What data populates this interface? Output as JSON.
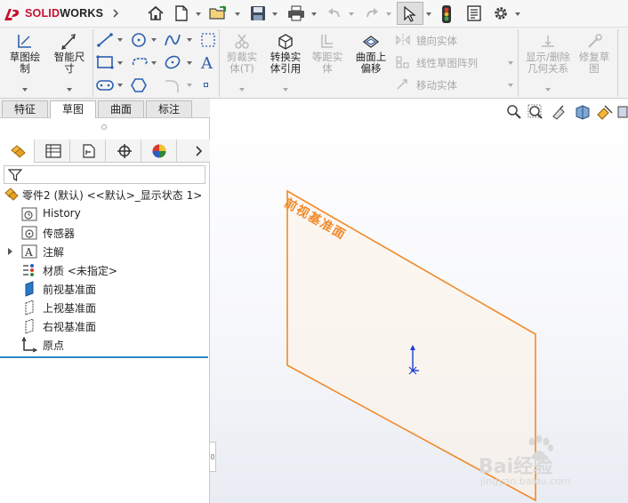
{
  "app": {
    "brand_prefix": "DS",
    "brand_name": "SOLIDWORKS"
  },
  "quick_access": {
    "icons": [
      "home-icon",
      "new-document-icon",
      "open-folder-icon",
      "save-icon",
      "print-icon",
      "undo-icon",
      "redo-icon",
      "select-pointer-icon",
      "traffic-light-icon",
      "file-properties-icon",
      "options-gear-icon"
    ]
  },
  "command_manager": {
    "sketch_label": "草图绘\n制",
    "smart_dim_label": "智能尺\n寸",
    "trim_label": "剪裁实\n体(T)",
    "convert_label": "转换实\n体引用",
    "offset_label": "等距实\n体",
    "offset_surface_label": "曲面上\n偏移",
    "mirror_label": "镜向实体",
    "linear_pattern_label": "线性草图阵列",
    "move_label": "移动实体",
    "show_relations_label": "显示/删除\n几何关系",
    "repair_label": "修复草\n图"
  },
  "tabs": [
    {
      "label": "特征",
      "active": false
    },
    {
      "label": "草图",
      "active": true
    },
    {
      "label": "曲面",
      "active": false
    },
    {
      "label": "标注",
      "active": false
    }
  ],
  "feature_tree": {
    "root": "零件2 (默认) <<默认>_显示状态 1>",
    "items": [
      {
        "label": "History",
        "icon": "history-icon",
        "expandable": false
      },
      {
        "label": "传感器",
        "icon": "sensor-icon",
        "expandable": false
      },
      {
        "label": "注解",
        "icon": "annotations-icon",
        "expandable": true
      },
      {
        "label": "材质 <未指定>",
        "icon": "material-icon",
        "expandable": false
      },
      {
        "label": "前视基准面",
        "icon": "plane-icon",
        "expandable": false
      },
      {
        "label": "上视基准面",
        "icon": "plane-icon",
        "expandable": false
      },
      {
        "label": "右视基准面",
        "icon": "plane-icon",
        "expandable": false
      },
      {
        "label": "原点",
        "icon": "origin-icon",
        "expandable": false
      }
    ]
  },
  "viewport": {
    "plane_label": "前视基准面",
    "accent_color": "#f08a2a",
    "origin_color": "#1a3fd0"
  },
  "watermark": {
    "brand": "Bai经验",
    "url": "jingyan.baidu.com"
  }
}
